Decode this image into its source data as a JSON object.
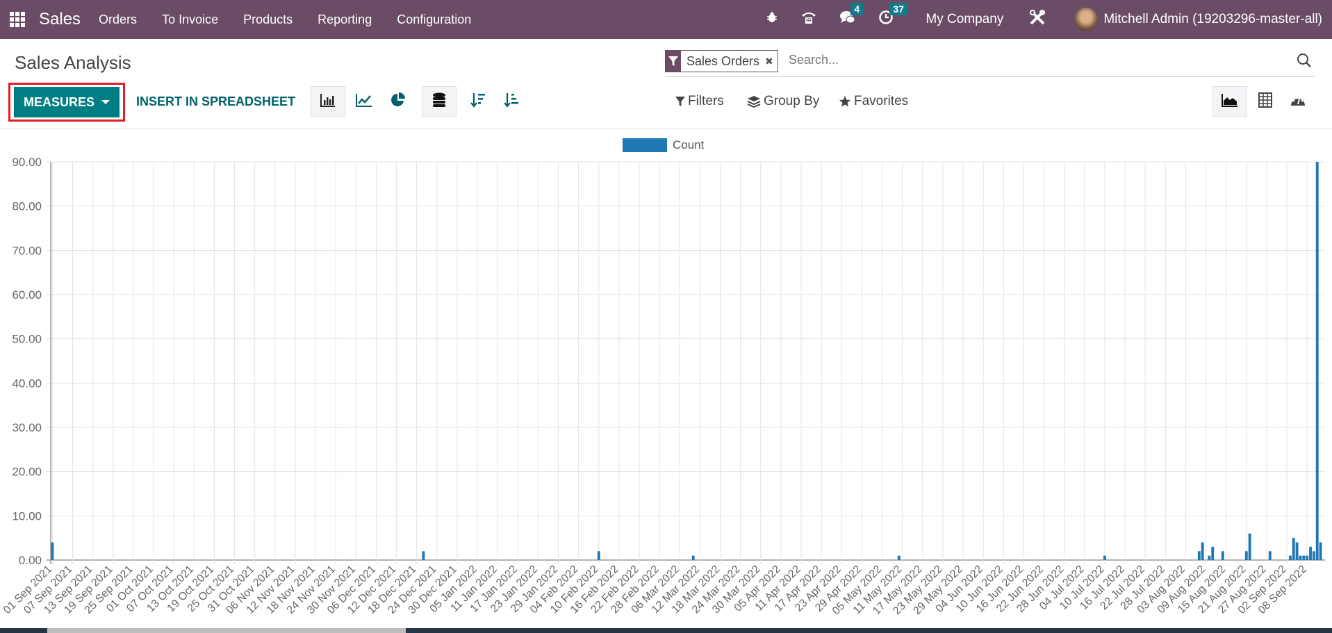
{
  "navbar": {
    "app_name": "Sales",
    "menu": [
      "Orders",
      "To Invoice",
      "Products",
      "Reporting",
      "Configuration"
    ],
    "messages_count": "4",
    "activities_count": "37",
    "company": "My Company",
    "user": "Mitchell Admin (19203296-master-all)"
  },
  "page": {
    "title": "Sales Analysis",
    "measures_label": "MEASURES",
    "insert_label": "INSERT IN SPREADSHEET"
  },
  "search": {
    "facet_label": "Sales Orders",
    "placeholder": "Search..."
  },
  "filters": {
    "filters_label": "Filters",
    "group_by_label": "Group By",
    "favorites_label": "Favorites"
  },
  "colors": {
    "navbar": "#6b4c66",
    "primary": "#017e84",
    "bar": "#1f77b4",
    "highlight": "#e31b23"
  },
  "chart_data": {
    "type": "bar",
    "title": "",
    "legend": [
      "Count"
    ],
    "legend_position": "top-center",
    "xlabel": "",
    "ylabel": "",
    "ylim": [
      0,
      90
    ],
    "y_ticks": [
      "0.00",
      "10.00",
      "20.00",
      "30.00",
      "40.00",
      "50.00",
      "60.00",
      "70.00",
      "80.00",
      "90.00"
    ],
    "x_range": [
      "01 Sep 2021",
      "12 Sep 2022"
    ],
    "x_ticks": [
      "01 Sep 2021",
      "07 Sep 2021",
      "13 Sep 2021",
      "19 Sep 2021",
      "25 Sep 2021",
      "01 Oct 2021",
      "07 Oct 2021",
      "13 Oct 2021",
      "19 Oct 2021",
      "25 Oct 2021",
      "31 Oct 2021",
      "06 Nov 2021",
      "12 Nov 2021",
      "18 Nov 2021",
      "24 Nov 2021",
      "30 Nov 2021",
      "06 Dec 2021",
      "12 Dec 2021",
      "18 Dec 2021",
      "24 Dec 2021",
      "30 Dec 2021",
      "05 Jan 2022",
      "11 Jan 2022",
      "17 Jan 2022",
      "23 Jan 2022",
      "29 Jan 2022",
      "04 Feb 2022",
      "10 Feb 2022",
      "16 Feb 2022",
      "22 Feb 2022",
      "28 Feb 2022",
      "06 Mar 2022",
      "12 Mar 2022",
      "18 Mar 2022",
      "24 Mar 2022",
      "30 Mar 2022",
      "05 Apr 2022",
      "11 Apr 2022",
      "17 Apr 2022",
      "23 Apr 2022",
      "29 Apr 2022",
      "05 May 2022",
      "11 May 2022",
      "17 May 2022",
      "23 May 2022",
      "29 May 2022",
      "04 Jun 2022",
      "10 Jun 2022",
      "16 Jun 2022",
      "22 Jun 2022",
      "28 Jun 2022",
      "04 Jul 2022",
      "10 Jul 2022",
      "16 Jul 2022",
      "22 Jul 2022",
      "28 Jul 2022",
      "03 Aug 2022",
      "09 Aug 2022",
      "15 Aug 2022",
      "21 Aug 2022",
      "27 Aug 2022",
      "02 Sep 2022",
      "08 Sep 2022"
    ],
    "grid": true,
    "series": [
      {
        "name": "Count",
        "points": [
          {
            "x": "01 Sep 2021",
            "y": 4
          },
          {
            "x": "20 Dec 2021",
            "y": 2
          },
          {
            "x": "10 Feb 2022",
            "y": 2
          },
          {
            "x": "10 Mar 2022",
            "y": 1
          },
          {
            "x": "10 May 2022",
            "y": 1
          },
          {
            "x": "10 Jul 2022",
            "y": 1
          },
          {
            "x": "07 Aug 2022",
            "y": 2
          },
          {
            "x": "08 Aug 2022",
            "y": 4
          },
          {
            "x": "10 Aug 2022",
            "y": 1
          },
          {
            "x": "11 Aug 2022",
            "y": 3
          },
          {
            "x": "14 Aug 2022",
            "y": 2
          },
          {
            "x": "21 Aug 2022",
            "y": 2
          },
          {
            "x": "22 Aug 2022",
            "y": 6
          },
          {
            "x": "28 Aug 2022",
            "y": 2
          },
          {
            "x": "03 Sep 2022",
            "y": 1
          },
          {
            "x": "04 Sep 2022",
            "y": 5
          },
          {
            "x": "05 Sep 2022",
            "y": 4
          },
          {
            "x": "06 Sep 2022",
            "y": 1
          },
          {
            "x": "07 Sep 2022",
            "y": 1
          },
          {
            "x": "08 Sep 2022",
            "y": 1
          },
          {
            "x": "09 Sep 2022",
            "y": 3
          },
          {
            "x": "10 Sep 2022",
            "y": 2
          },
          {
            "x": "11 Sep 2022",
            "y": 90
          },
          {
            "x": "12 Sep 2022",
            "y": 4
          }
        ]
      }
    ]
  }
}
